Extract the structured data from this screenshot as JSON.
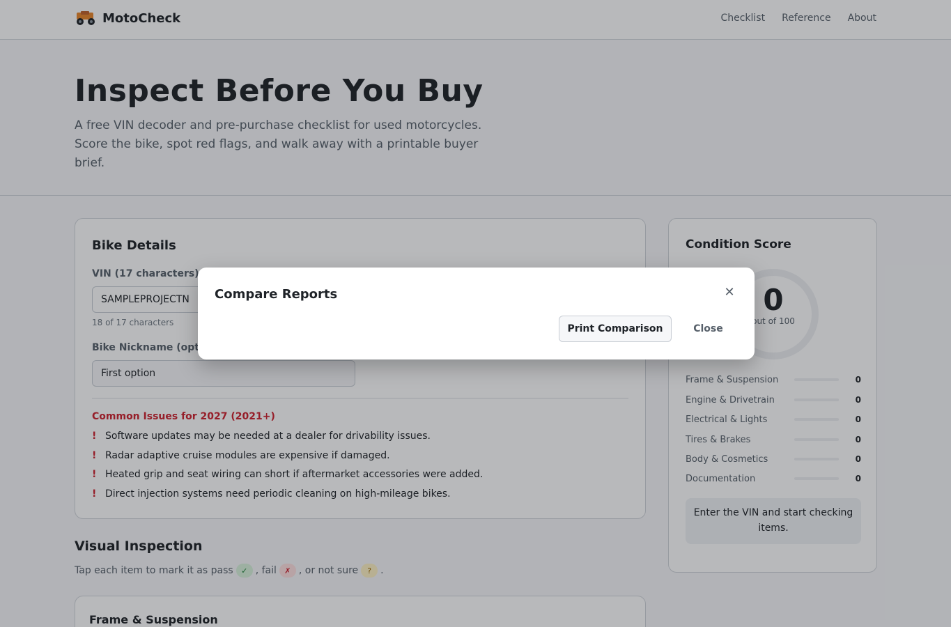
{
  "header": {
    "brand": "MotoCheck",
    "logo_icon": "motorcycle-icon",
    "nav": [
      "Checklist",
      "Reference",
      "About"
    ]
  },
  "hero": {
    "title": "Inspect Before You Buy",
    "subtitle": "A free VIN decoder and pre-purchase checklist for used motorcycles. Score the bike, spot red flags, and walk away with a printable buyer brief."
  },
  "bike_details": {
    "title": "Bike Details",
    "vin_label": "VIN (17 characters)",
    "vin_value": "SAMPLEPROJECTN",
    "vin_hint": "18 of 17 characters",
    "nickname_label": "Bike Nickname (opti",
    "nickname_value": "First option",
    "issues_title": "Common Issues for 2027 (2021+)",
    "issues": [
      "Software updates may be needed at a dealer for drivability issues.",
      "Radar adaptive cruise modules are expensive if damaged.",
      "Heated grip and seat wiring can short if aftermarket accessories were added.",
      "Direct injection systems need periodic cleaning on high-mileage bikes."
    ],
    "issue_marker": "!"
  },
  "visual_inspection": {
    "title": "Visual Inspection",
    "instructions_prefix": "Tap each item to mark it as pass",
    "fail_text": ", fail",
    "unsure_text": ", or not sure",
    "end_text": ".",
    "pass_glyph": "✓",
    "fail_glyph": "✗",
    "unsure_glyph": "?",
    "first_section": "Frame & Suspension"
  },
  "score": {
    "title": "Condition Score",
    "value": "0",
    "out_of": "out of 100",
    "categories": [
      {
        "label": "Frame & Suspension",
        "value": "0"
      },
      {
        "label": "Engine & Drivetrain",
        "value": "0"
      },
      {
        "label": "Electrical & Lights",
        "value": "0"
      },
      {
        "label": "Tires & Brakes",
        "value": "0"
      },
      {
        "label": "Body & Cosmetics",
        "value": "0"
      },
      {
        "label": "Documentation",
        "value": "0"
      }
    ],
    "note": "Enter the VIN and start checking items."
  },
  "modal": {
    "title": "Compare Reports",
    "close_icon": "close-icon",
    "close_glyph": "✕",
    "print_label": "Print Comparison",
    "close_label": "Close"
  },
  "colors": {
    "accent_red": "#cf222e",
    "pass_green": "#1a7f37",
    "logo_orange": "#e8862a"
  }
}
